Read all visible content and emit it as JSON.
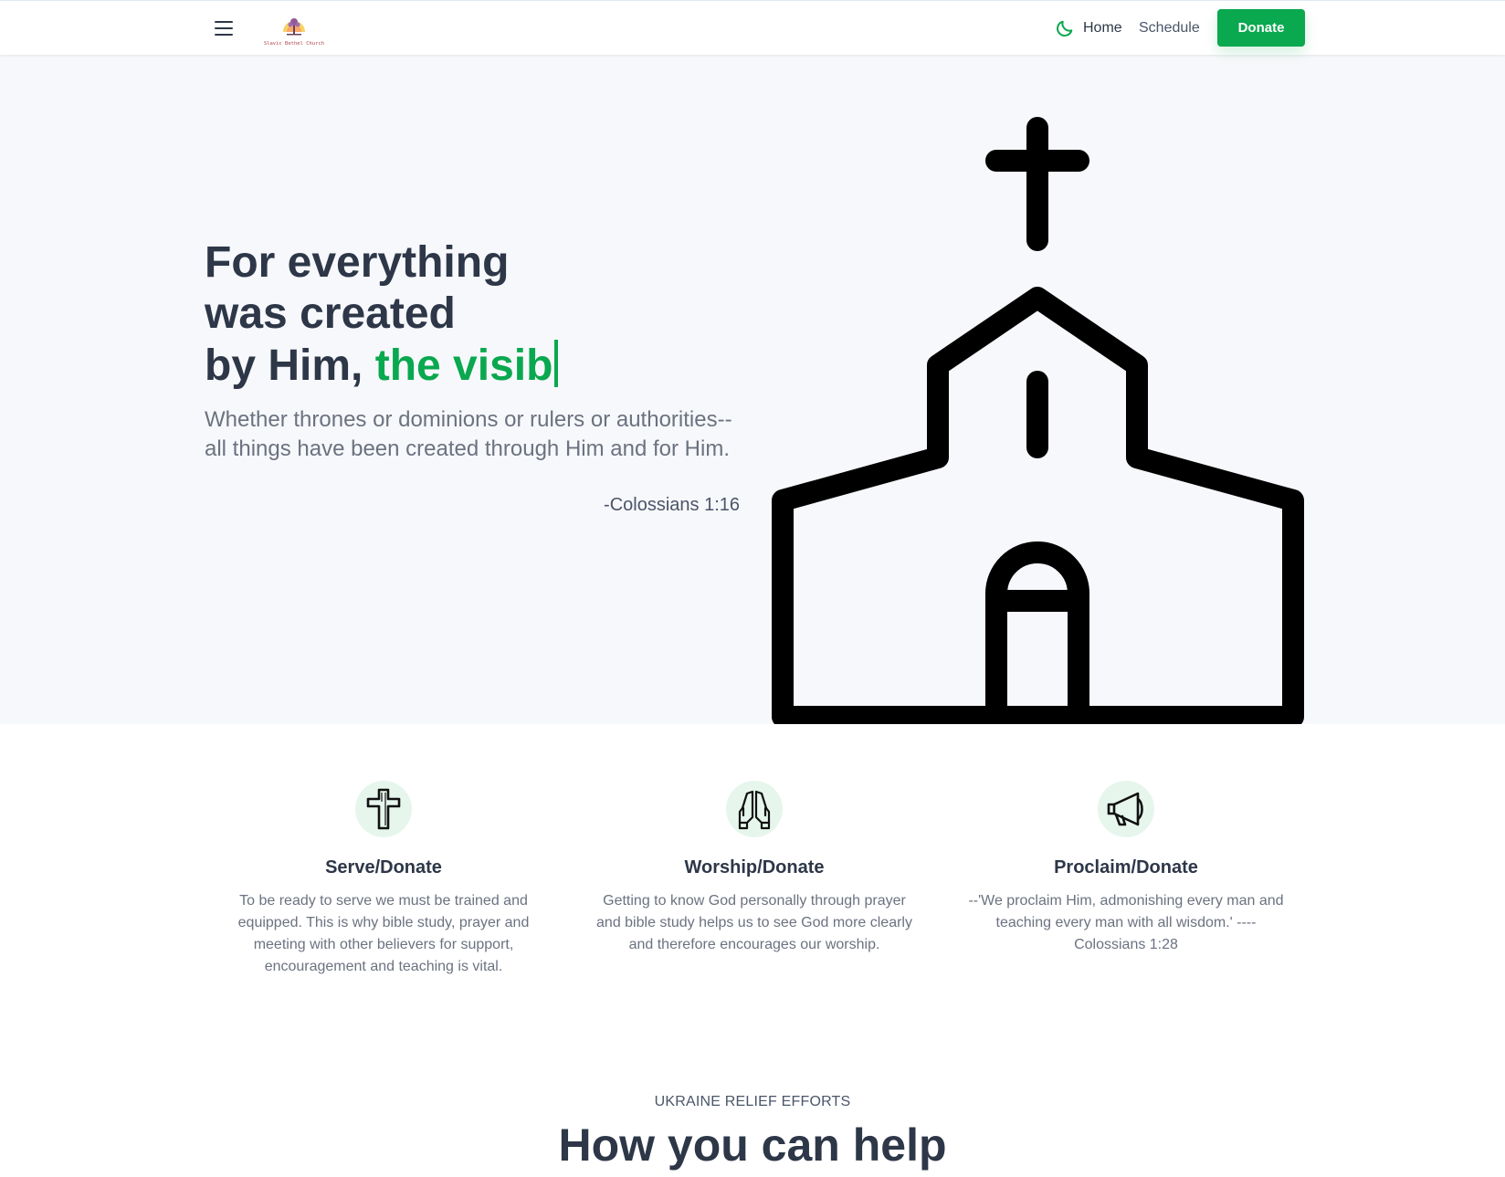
{
  "header": {
    "logo_text": "Slavic Bethel Church",
    "nav": {
      "home": "Home",
      "schedule": "Schedule",
      "donate": "Donate"
    },
    "icons": {
      "menu": "hamburger-menu-icon",
      "theme": "moon-icon"
    }
  },
  "hero": {
    "title_line1": "For everything",
    "title_line2": "was created",
    "title_line3_prefix": "by Him, ",
    "title_typed": "the visib",
    "verse": "Whether thrones or dominions or rulers or authorities-- all things have been created through Him and for Him.",
    "citation": "-Colossians 1:16",
    "illustration": "church-icon"
  },
  "features": [
    {
      "icon": "cross-icon",
      "title": "Serve/Donate",
      "text": "To be ready to serve we must be trained and equipped. This is why bible study, prayer and meeting with other believers for support, encouragement and teaching is vital."
    },
    {
      "icon": "praying-hands-icon",
      "title": "Worship/Donate",
      "text": "Getting to know God personally through prayer and bible study helps us to see God more clearly and therefore encourages our worship."
    },
    {
      "icon": "megaphone-icon",
      "title": "Proclaim/Donate",
      "text": "--'We proclaim Him, admonishing every man and teaching every man with all wisdom.' ---- Colossians 1:28"
    }
  ],
  "help_section": {
    "eyebrow": "UKRAINE RELIEF EFFORTS",
    "heading": "How you can help"
  },
  "colors": {
    "accent": "#0aa84f",
    "hero_bg": "#f7f8fb",
    "heading": "#2d3748",
    "muted": "#6b7280",
    "icon_circle": "#e6f6ed"
  }
}
